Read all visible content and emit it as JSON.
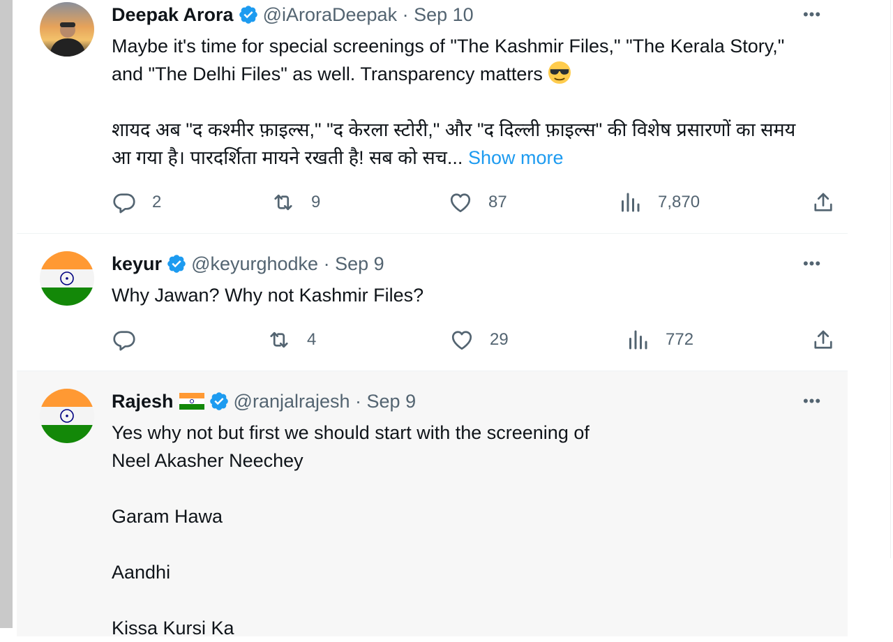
{
  "tweets": [
    {
      "name": "Deepak Arora",
      "handle": "@iAroraDeepak",
      "date": "Sep 10",
      "verified": true,
      "more_label": "•••",
      "paragraphs": [
        "Maybe it's time for special screenings of \"The Kashmir Files,\" \"The Kerala Story,\" and \"The Delhi Files\" as well. Transparency matters",
        "शायद अब \"द कश्मीर फ़ाइल्स,\" \"द केरला स्टोरी,\" और \"द दिल्ली फ़ाइल्स\" की विशेष प्रसारणों का समय आ गया है। पारदर्शिता मायने रखती है! सब को सच..."
      ],
      "show_more": "Show more",
      "stats": {
        "replies": "2",
        "retweets": "9",
        "likes": "87",
        "views": "7,870"
      }
    },
    {
      "name": "keyur",
      "handle": "@keyurghodke",
      "date": "Sep 9",
      "verified": true,
      "more_label": "•••",
      "text": "Why Jawan? Why not Kashmir Files?",
      "stats": {
        "replies": "",
        "retweets": "4",
        "likes": "29",
        "views": "772"
      }
    },
    {
      "name": "Rajesh",
      "handle": "@ranjalrajesh",
      "date": "Sep 9",
      "verified": true,
      "more_label": "•••",
      "lines": [
        "Yes why not but first we should start with the screening of",
        "Neel Akasher Neechey",
        "Garam Hawa",
        "Aandhi",
        "Kissa Kursi Ka"
      ]
    }
  ],
  "separator": " · ",
  "colors": {
    "accent": "#1d9bf0",
    "text": "#0f1419",
    "secondary": "#536471",
    "highlight_bg": "#f7f7f7"
  },
  "icons": [
    "reply-icon",
    "retweet-icon",
    "like-icon",
    "views-icon",
    "share-icon",
    "verified-badge-icon",
    "more-icon",
    "sunglasses-emoji",
    "india-flag-icon"
  ]
}
